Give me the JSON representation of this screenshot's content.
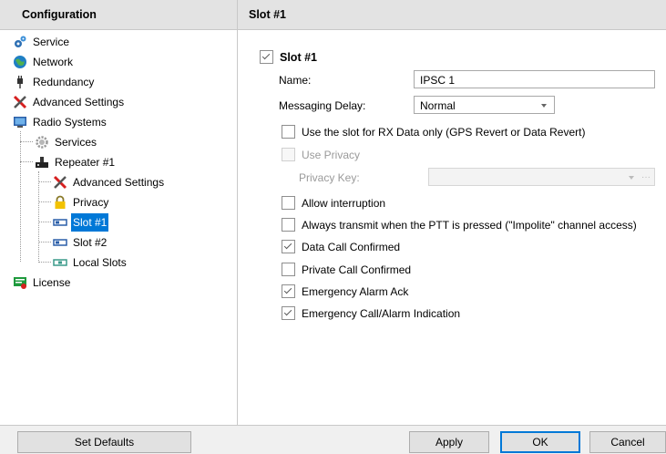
{
  "sidebar": {
    "title": "Configuration",
    "items": [
      {
        "label": "Service",
        "icon": "gears-icon"
      },
      {
        "label": "Network",
        "icon": "globe-icon"
      },
      {
        "label": "Redundancy",
        "icon": "plug-icon"
      },
      {
        "label": "Advanced Settings",
        "icon": "tools-icon"
      },
      {
        "label": "Radio Systems",
        "icon": "computer-icon"
      },
      {
        "label": "Services",
        "icon": "gear-icon"
      },
      {
        "label": "Repeater #1",
        "icon": "repeater-icon"
      },
      {
        "label": "Advanced Settings",
        "icon": "tools-icon"
      },
      {
        "label": "Privacy",
        "icon": "lock-icon"
      },
      {
        "label": "Slot #1",
        "icon": "slot-icon",
        "selected": true
      },
      {
        "label": "Slot #2",
        "icon": "slot-icon"
      },
      {
        "label": "Local Slots",
        "icon": "local-slot-icon"
      },
      {
        "label": "License",
        "icon": "license-icon"
      }
    ]
  },
  "panel": {
    "title": "Slot #1",
    "slot_enable": {
      "label": "Slot #1",
      "checked": true
    },
    "name": {
      "label": "Name:",
      "value": "IPSC 1"
    },
    "messaging_delay": {
      "label": "Messaging Delay:",
      "value": "Normal"
    },
    "rx_only": {
      "label": "Use the slot for RX Data only (GPS Revert or Data Revert)",
      "checked": false
    },
    "use_privacy": {
      "label": "Use Privacy",
      "checked": false,
      "disabled": true
    },
    "privacy_key": {
      "label": "Privacy Key:",
      "value": "",
      "ellipsis": "···"
    },
    "allow_interruption": {
      "label": "Allow interruption",
      "checked": false
    },
    "always_transmit": {
      "label": "Always transmit when the PTT is pressed (\"Impolite\" channel access)",
      "checked": false
    },
    "data_call_confirmed": {
      "label": "Data Call Confirmed",
      "checked": true
    },
    "private_call_confirmed": {
      "label": "Private Call Confirmed",
      "checked": false
    },
    "emergency_alarm_ack": {
      "label": "Emergency Alarm Ack",
      "checked": true
    },
    "emergency_call_indication": {
      "label": "Emergency Call/Alarm Indication",
      "checked": true
    }
  },
  "buttons": {
    "set_defaults": "Set Defaults",
    "apply": "Apply",
    "ok": "OK",
    "cancel": "Cancel"
  },
  "colors": {
    "selection": "#0078d7",
    "header_bg": "#e3e3e3"
  }
}
